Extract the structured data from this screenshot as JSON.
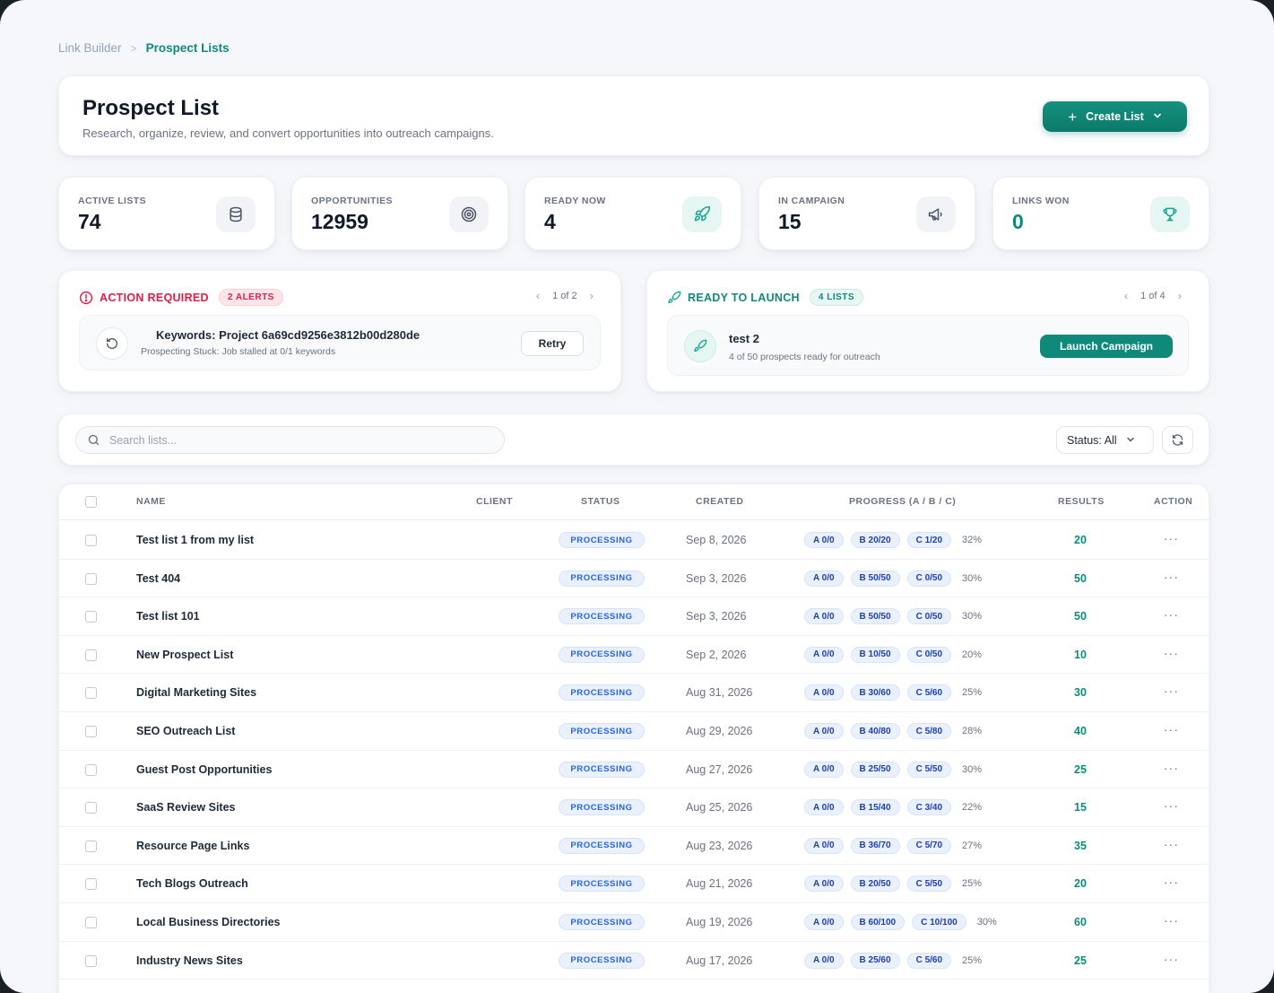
{
  "breadcrumb": {
    "parent": "Link Builder",
    "separator": ">",
    "current": "Prospect Lists"
  },
  "header": {
    "title": "Prospect List",
    "subtitle": "Research, organize, review, and convert opportunities into outreach campaigns.",
    "create_button": "Create List",
    "create_plus": "+",
    "create_chevron": "⌄"
  },
  "stats": [
    {
      "label": "ACTIVE LISTS",
      "value": "74",
      "icon": "database-icon"
    },
    {
      "label": "OPPORTUNITIES",
      "value": "12959",
      "icon": "target-icon"
    },
    {
      "label": "READY NOW",
      "value": "4",
      "icon": "rocket-icon"
    },
    {
      "label": "IN CAMPAIGN",
      "value": "15",
      "icon": "megaphone-icon"
    },
    {
      "label": "LINKS WON",
      "value": "0",
      "icon": "trophy-icon"
    }
  ],
  "action_required": {
    "title": "ACTION REQUIRED",
    "badge": "2 ALERTS",
    "pager": "1 of 2",
    "prev": "‹",
    "next": "›",
    "item_title": "Keywords: Project 6a69cd9256e3812b00d280de",
    "item_sub": "Prospecting Stuck: Job stalled at 0/1 keywords",
    "button": "Retry"
  },
  "ready_to_launch": {
    "title": "READY TO LAUNCH",
    "badge": "4 LISTS",
    "pager": "1 of 4",
    "prev": "‹",
    "next": "›",
    "item_title": "test 2",
    "item_sub": "4 of 50 prospects ready for outreach",
    "button": "Launch Campaign"
  },
  "search": {
    "placeholder": "Search lists...",
    "value": ""
  },
  "status_filter": {
    "label": "Status: All",
    "chevron": "⌄"
  },
  "colors": {
    "accent": "#0f8a7a",
    "alert": "#e11d48",
    "status_blue": "#2563eb"
  },
  "table": {
    "columns": {
      "name": "NAME",
      "client": "CLIENT",
      "status": "STATUS",
      "created": "CREATED",
      "progress": "PROGRESS (A / B / C)",
      "results": "RESULTS",
      "action": "ACTION"
    },
    "more": "···",
    "rows": [
      {
        "name": "Test list 1 from my list",
        "status": "PROCESSING",
        "created": "Sep 8, 2026",
        "a": "A 0/0",
        "b": "B 20/20",
        "c": "C 1/20",
        "pct": "32%",
        "results": "20"
      },
      {
        "name": "Test 404",
        "status": "PROCESSING",
        "created": "Sep 3, 2026",
        "a": "A 0/0",
        "b": "B 50/50",
        "c": "C 0/50",
        "pct": "30%",
        "results": "50"
      },
      {
        "name": "Test list 101",
        "status": "PROCESSING",
        "created": "Sep 3, 2026",
        "a": "A 0/0",
        "b": "B 50/50",
        "c": "C 0/50",
        "pct": "30%",
        "results": "50"
      },
      {
        "name": "New Prospect List",
        "status": "PROCESSING",
        "created": "Sep 2, 2026",
        "a": "A 0/0",
        "b": "B 10/50",
        "c": "C 0/50",
        "pct": "20%",
        "results": "10"
      },
      {
        "name": "Digital Marketing Sites",
        "status": "PROCESSING",
        "created": "Aug 31, 2026",
        "a": "A 0/0",
        "b": "B 30/60",
        "c": "C 5/60",
        "pct": "25%",
        "results": "30"
      },
      {
        "name": "SEO Outreach List",
        "status": "PROCESSING",
        "created": "Aug 29, 2026",
        "a": "A 0/0",
        "b": "B 40/80",
        "c": "C 5/80",
        "pct": "28%",
        "results": "40"
      },
      {
        "name": "Guest Post Opportunities",
        "status": "PROCESSING",
        "created": "Aug 27, 2026",
        "a": "A 0/0",
        "b": "B 25/50",
        "c": "C 5/50",
        "pct": "30%",
        "results": "25"
      },
      {
        "name": "SaaS Review Sites",
        "status": "PROCESSING",
        "created": "Aug 25, 2026",
        "a": "A 0/0",
        "b": "B 15/40",
        "c": "C 3/40",
        "pct": "22%",
        "results": "15"
      },
      {
        "name": "Resource Page Links",
        "status": "PROCESSING",
        "created": "Aug 23, 2026",
        "a": "A 0/0",
        "b": "B 36/70",
        "c": "C 5/70",
        "pct": "27%",
        "results": "35"
      },
      {
        "name": "Tech Blogs Outreach",
        "status": "PROCESSING",
        "created": "Aug 21, 2026",
        "a": "A 0/0",
        "b": "B 20/50",
        "c": "C 5/50",
        "pct": "25%",
        "results": "20"
      },
      {
        "name": "Local Business Directories",
        "status": "PROCESSING",
        "created": "Aug 19, 2026",
        "a": "A 0/0",
        "b": "B 60/100",
        "c": "C 10/100",
        "pct": "30%",
        "results": "60"
      },
      {
        "name": "Industry News Sites",
        "status": "PROCESSING",
        "created": "Aug 17, 2026",
        "a": "A 0/0",
        "b": "B 25/60",
        "c": "C 5/60",
        "pct": "25%",
        "results": "25"
      }
    ]
  }
}
